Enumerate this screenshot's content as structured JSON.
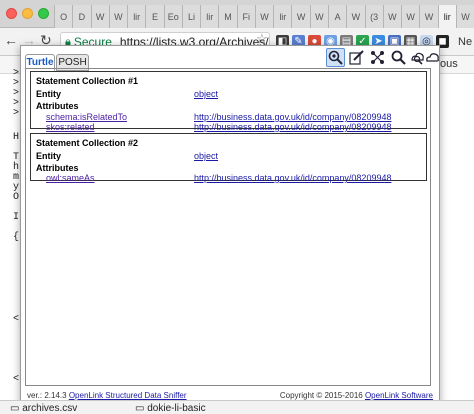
{
  "browser": {
    "tabs": [
      "O",
      "D",
      "W",
      "W",
      "lir",
      "E",
      "Eo",
      "Li",
      "lir",
      "M",
      "Fi",
      "W",
      "lir",
      "W",
      "W",
      "A",
      "W",
      "(3",
      "W",
      "W",
      "W",
      "lir",
      "W"
    ],
    "address": {
      "secure_label": "Secure",
      "url": "https://lists.w3.org/Archives/Pu..."
    },
    "extension_label": "Ne",
    "bookmark_label": "ous"
  },
  "page_behind": {
    "chars": [
      ">",
      ">",
      ">",
      ">",
      ">",
      "H",
      "T",
      "h",
      "m",
      "y",
      "O",
      "I",
      "{",
      "<",
      "<"
    ]
  },
  "sniffer": {
    "tabs": {
      "turtle": "Turtle",
      "posh": "POSH"
    },
    "toolbar_icons": [
      "sniffer-icon",
      "edit-icon",
      "graph-icon",
      "search-icon",
      "search-cloud-icon",
      "cloud-icon"
    ],
    "collections": [
      {
        "title": "Statement Collection #1",
        "entity_label": "Entity",
        "entity_value": "object",
        "attributes_label": "Attributes",
        "attributes": [
          {
            "predicate": "schema:isRelatedTo",
            "value": "http://business.data.gov.uk/id/company/08209948"
          },
          {
            "predicate": "skos:related",
            "value": "http://business.data.gov.uk/id/company/08209948"
          }
        ]
      },
      {
        "title": "Statement Collection #2",
        "entity_label": "Entity",
        "entity_value": "object",
        "attributes_label": "Attributes",
        "attributes": [
          {
            "predicate": "owl:sameAs",
            "value": "http://business.data.gov.uk/id/company/08209948"
          }
        ]
      }
    ],
    "footer": {
      "version": "ver.: 2.14.3",
      "product_link": "OpenLink Structured Data Sniffer",
      "copyright": "Copyright © 2015-2016",
      "company_link": "OpenLink Software"
    }
  },
  "downloads": {
    "items": [
      "archives.csv",
      "dokie-li-basic"
    ]
  },
  "colors": {
    "link": "#1a1aa6",
    "visited_link": "#4a1fa3",
    "accent": "#1a5ac8"
  }
}
